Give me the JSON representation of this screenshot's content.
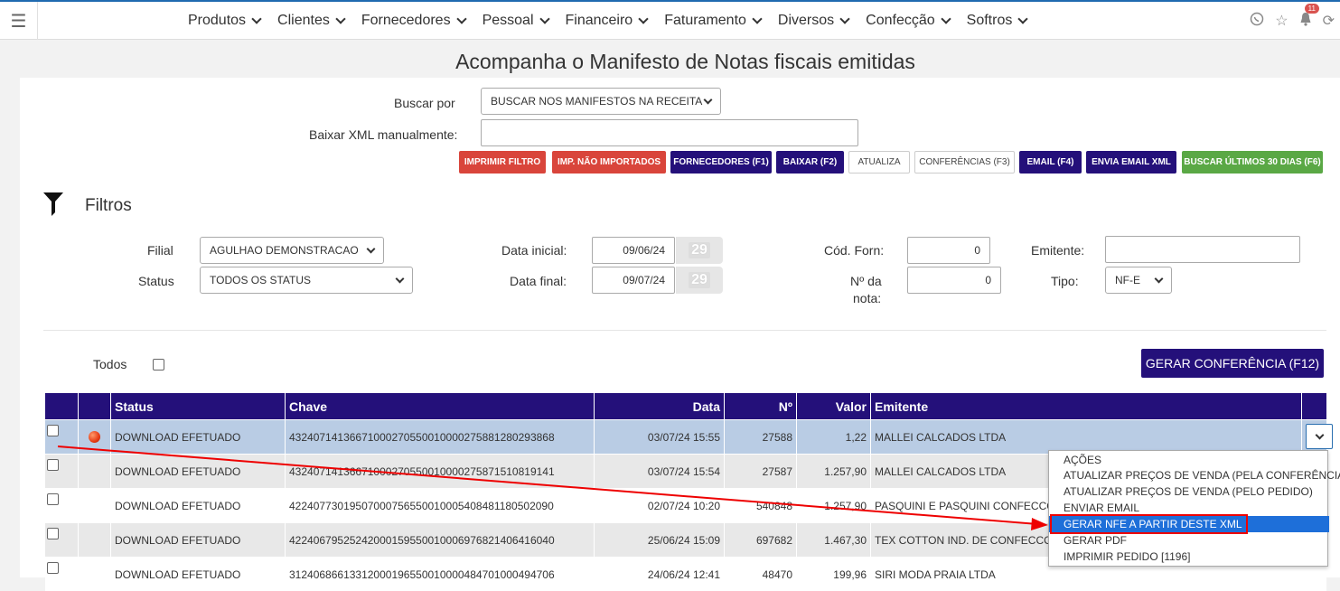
{
  "nav": {
    "menu": [
      "Produtos",
      "Clientes",
      "Fornecedores",
      "Pessoal",
      "Financeiro",
      "Faturamento",
      "Diversos",
      "Confecção",
      "Softros"
    ],
    "notification_count": "11"
  },
  "page_title": "Acompanha o Manifesto de Notas fiscais emitidas",
  "search": {
    "buscar_por_label": "Buscar por",
    "buscar_por_value": "BUSCAR NOS MANIFESTOS NA RECEITA",
    "baixar_label": "Baixar XML manualmente:",
    "baixar_value": ""
  },
  "buttons": {
    "imprimir_filtro": "IMPRIMIR FILTRO",
    "imp_nao_importados": "IMP. NÃO IMPORTADOS",
    "fornecedores": "FORNECEDORES (F1)",
    "baixar": "BAIXAR (F2)",
    "atualiza": "ATUALIZA",
    "conferencias": "CONFERÊNCIAS (F3)",
    "email": "EMAIL (F4)",
    "envia_email_xml": "ENVIA EMAIL XML",
    "buscar_ultimos": "BUSCAR ÚLTIMOS 30 DIAS (F6)",
    "gerar_conferencia": "GERAR CONFERÊNCIA (F12)"
  },
  "filters": {
    "title": "Filtros",
    "filial_label": "Filial",
    "filial_value": "AGULHAO DEMONSTRACAO",
    "status_label": "Status",
    "status_value": "TODOS OS STATUS",
    "data_inicial_label": "Data inicial:",
    "data_inicial_value": "09/06/24",
    "data_final_label": "Data final:",
    "data_final_value": "09/07/24",
    "cal_day": "29",
    "cod_forn_label": "Cód. Forn:",
    "cod_forn_value": "0",
    "num_nota_label_1": "Nº da",
    "num_nota_label_2": "nota:",
    "num_nota_value": "0",
    "emitente_label": "Emitente:",
    "emitente_value": "",
    "tipo_label": "Tipo:",
    "tipo_value": "NF-E"
  },
  "todos_label": "Todos",
  "table": {
    "headers": {
      "status": "Status",
      "chave": "Chave",
      "data": "Data",
      "numero": "Nº",
      "valor": "Valor",
      "emitente": "Emitente"
    },
    "rows": [
      {
        "status": "DOWNLOAD EFETUADO",
        "chave": "43240714136671000270550010000275881280293868",
        "data": "03/07/24 15:55",
        "numero": "27588",
        "valor": "1,22",
        "emitente": "MALLEI CALCADOS LTDA"
      },
      {
        "status": "DOWNLOAD EFETUADO",
        "chave": "43240714136671000270550010000275871510819141",
        "data": "03/07/24 15:54",
        "numero": "27587",
        "valor": "1.257,90",
        "emitente": "MALLEI CALCADOS LTDA"
      },
      {
        "status": "DOWNLOAD EFETUADO",
        "chave": "42240773019507000756550010005408481180502090",
        "data": "02/07/24 10:20",
        "numero": "540848",
        "valor": "1.257,90",
        "emitente": "PASQUINI E PASQUINI CONFECCOES"
      },
      {
        "status": "DOWNLOAD EFETUADO",
        "chave": "42240679525242000159550010006976821406416040",
        "data": "25/06/24 15:09",
        "numero": "697682",
        "valor": "1.467,30",
        "emitente": "TEX COTTON IND. DE CONFECCOES"
      },
      {
        "status": "DOWNLOAD EFETUADO",
        "chave": "31240686613312000196550010000484701000494706",
        "data": "24/06/24 12:41",
        "numero": "48470",
        "valor": "199,96",
        "emitente": "SIRI MODA PRAIA LTDA"
      }
    ]
  },
  "dropdown": {
    "items": [
      "AÇÕES",
      "ATUALIZAR PREÇOS DE VENDA (PELA CONFERÊNCIA)",
      "ATUALIZAR PREÇOS DE VENDA (PELO PEDIDO)",
      "ENVIAR EMAIL",
      "GERAR NFE A PARTIR DESTE XML",
      "GERAR PDF",
      "IMPRIMIR PEDIDO [1196]"
    ],
    "active_index": 4
  }
}
